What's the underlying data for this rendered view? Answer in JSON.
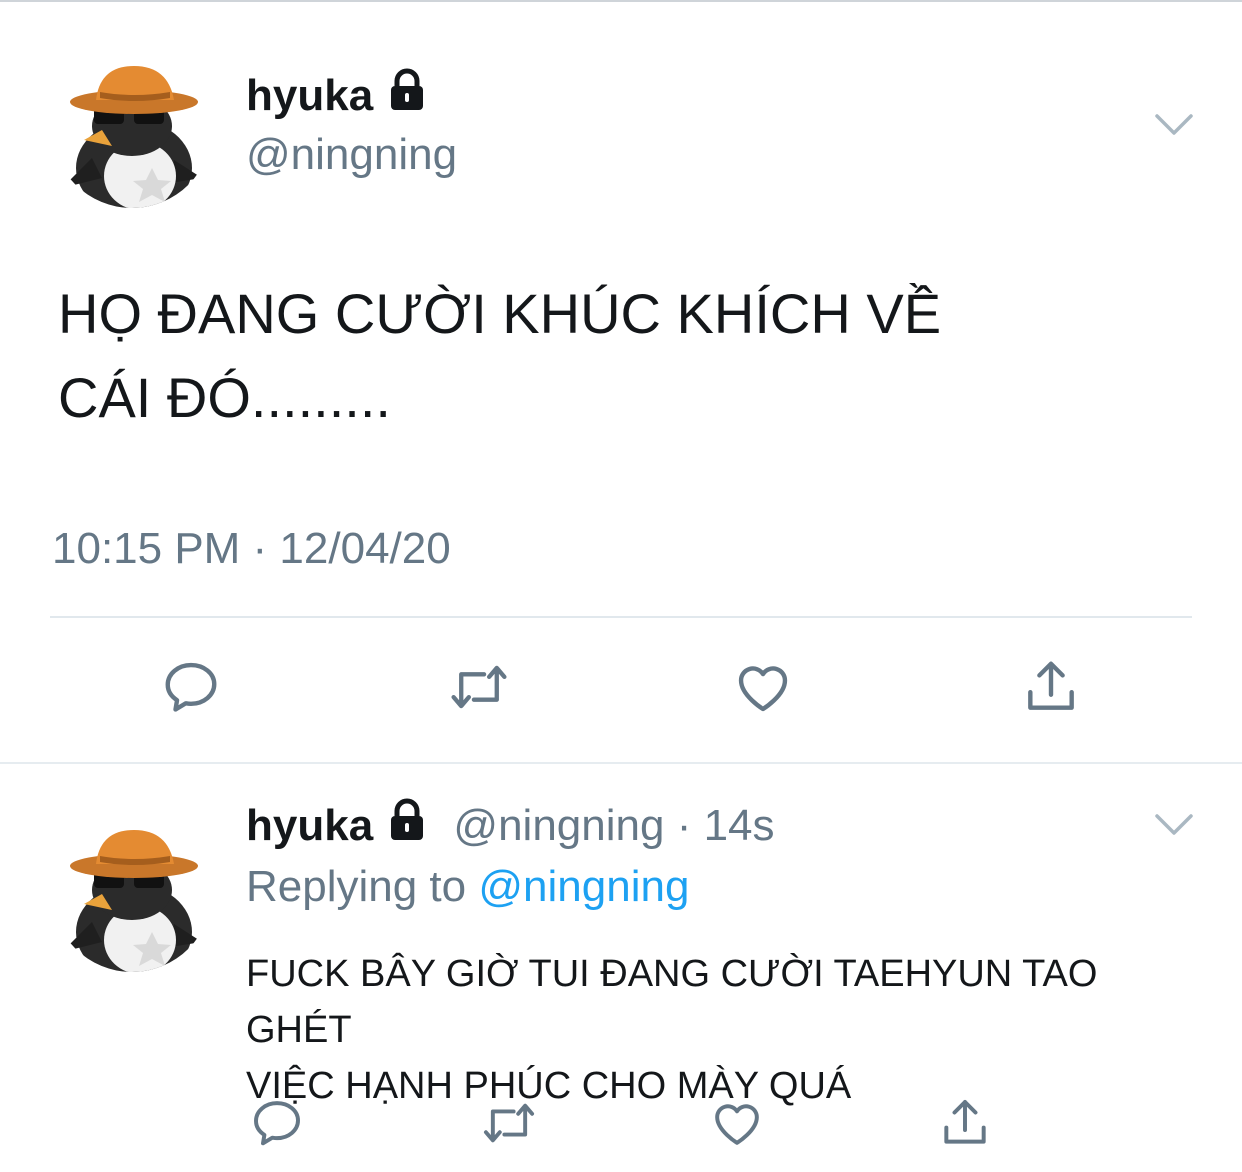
{
  "colors": {
    "text_primary": "#14171a",
    "text_secondary": "#657786",
    "mention_blue": "#1da1f2",
    "divider": "#e1e8ed"
  },
  "main_tweet": {
    "display_name": "hyuka",
    "handle": "@ningning",
    "text_line1": "HỌ ĐANG CƯỜI KHÚC KHÍCH VỀ",
    "text_line2": "CÁI ĐÓ.........",
    "timestamp": "10:15 PM · 12/04/20",
    "locked_icon": "lock-icon",
    "menu_icon": "chevron-down-icon",
    "actions": [
      "reply-icon",
      "retweet-icon",
      "like-icon",
      "share-icon"
    ]
  },
  "reply_tweet": {
    "display_name": "hyuka",
    "handle": "@ningning",
    "separator": "·",
    "time": "14s",
    "replying_prefix": "Replying to",
    "replying_to": "@ningning",
    "text_line1": "FUCK BÂY GIỜ TUI ĐANG CƯỜI TAEHYUN TAO GHÉT",
    "text_line2": "VIỆC HẠNH PHÚC CHO MÀY QUÁ",
    "locked_icon": "lock-icon",
    "menu_icon": "chevron-down-icon",
    "actions": [
      "reply-icon",
      "retweet-icon",
      "like-icon",
      "share-icon"
    ]
  }
}
